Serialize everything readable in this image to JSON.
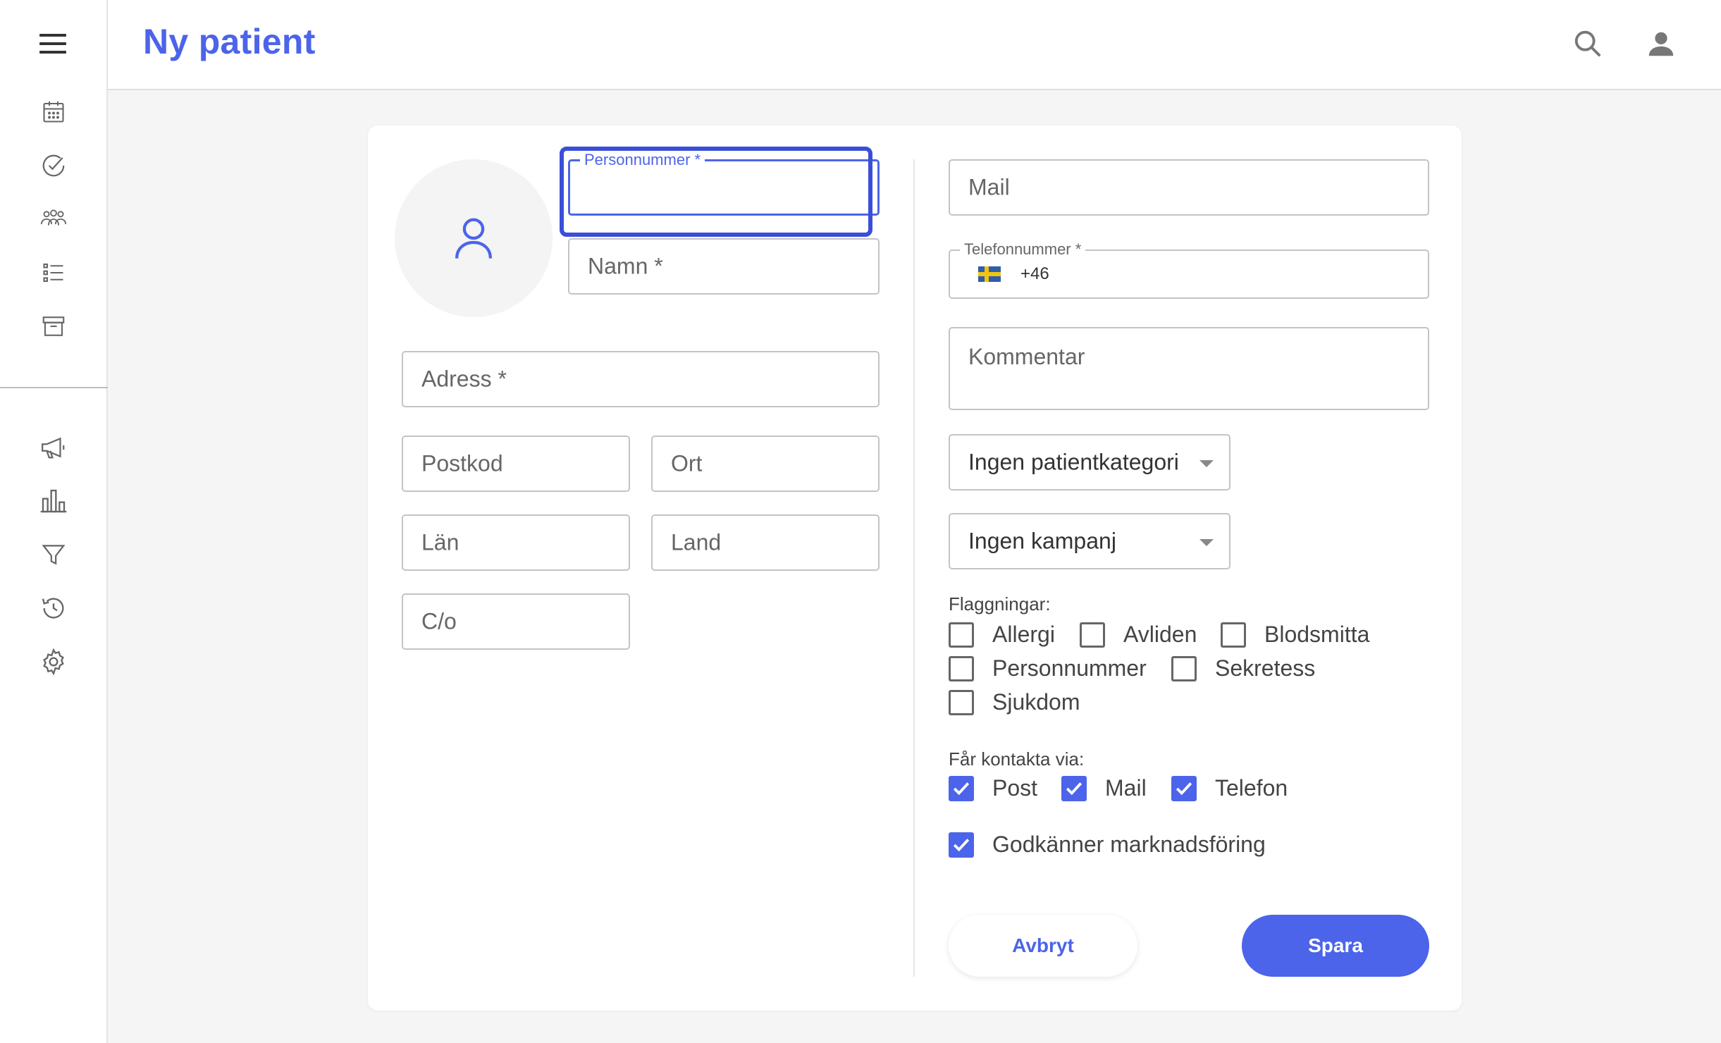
{
  "header": {
    "title": "Ny patient"
  },
  "sidebar": {
    "icons": [
      "menu-icon",
      "calendar-icon",
      "check-circle-icon",
      "group-icon",
      "list-icon",
      "archive-icon",
      "megaphone-icon",
      "bar-chart-icon",
      "filter-icon",
      "history-icon",
      "settings-icon"
    ]
  },
  "form": {
    "personnummer": {
      "label": "Personnummer *",
      "value": ""
    },
    "namn": {
      "placeholder": "Namn *"
    },
    "adress": {
      "placeholder": "Adress *"
    },
    "postkod": {
      "placeholder": "Postkod"
    },
    "ort": {
      "placeholder": "Ort"
    },
    "lan": {
      "placeholder": "Län"
    },
    "land": {
      "placeholder": "Land"
    },
    "co": {
      "placeholder": "C/o"
    },
    "mail": {
      "placeholder": "Mail"
    },
    "telefon": {
      "label": "Telefonnummer *",
      "prefix": "+46",
      "country": "SE"
    },
    "kommentar": {
      "placeholder": "Kommentar"
    },
    "patientkategori": {
      "selected": "Ingen patientkategori"
    },
    "kampanj": {
      "selected": "Ingen kampanj"
    },
    "flaggningar": {
      "label": "Flaggningar:",
      "options": [
        {
          "label": "Allergi",
          "checked": false
        },
        {
          "label": "Avliden",
          "checked": false
        },
        {
          "label": "Blodsmitta",
          "checked": false
        },
        {
          "label": "Personnummer",
          "checked": false
        },
        {
          "label": "Sekretess",
          "checked": false
        },
        {
          "label": "Sjukdom",
          "checked": false
        }
      ]
    },
    "kontakt": {
      "label": "Får kontakta via:",
      "options": [
        {
          "label": "Post",
          "checked": true
        },
        {
          "label": "Mail",
          "checked": true
        },
        {
          "label": "Telefon",
          "checked": true
        }
      ]
    },
    "marknadsforing": {
      "label": "Godkänner marknadsföring",
      "checked": true
    }
  },
  "actions": {
    "cancel_label": "Avbryt",
    "save_label": "Spara"
  },
  "colors": {
    "accent": "#4c64ea",
    "focus_ring": "#3a4fd8"
  }
}
